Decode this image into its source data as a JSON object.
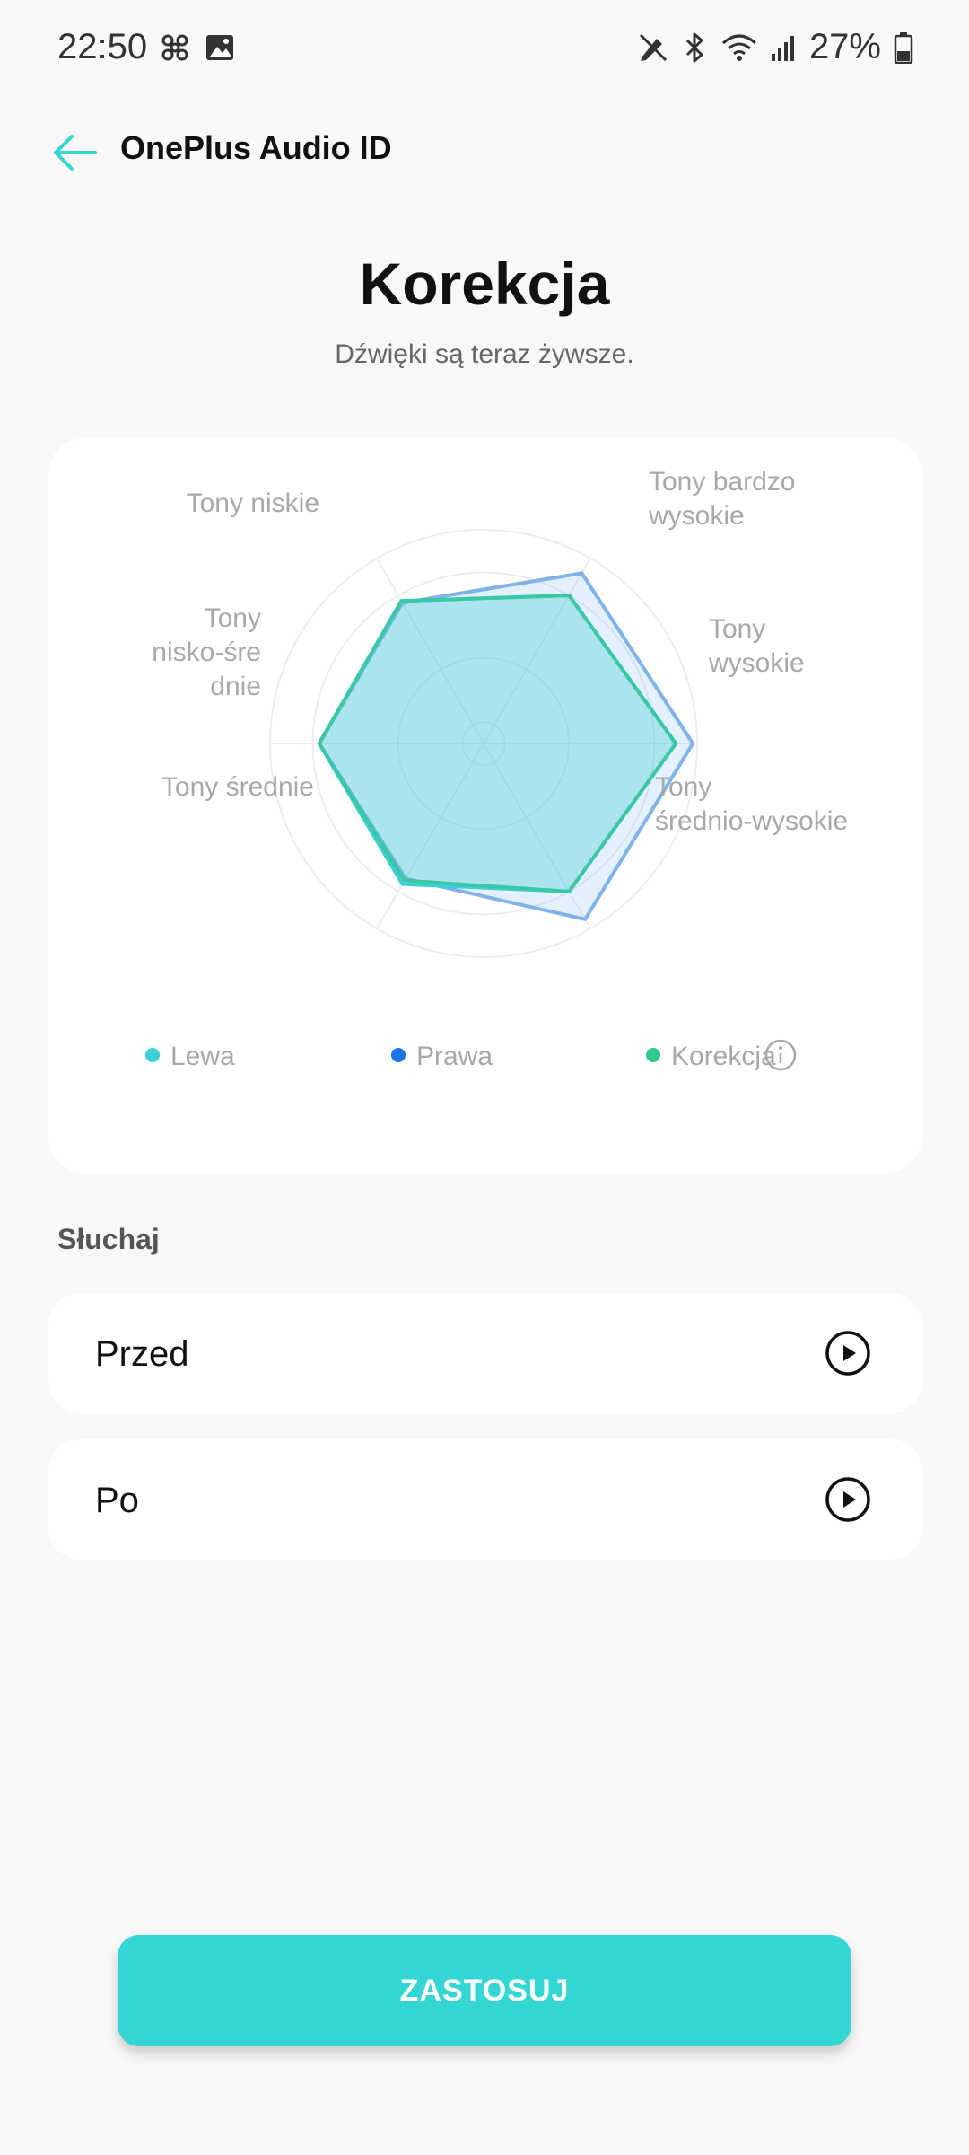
{
  "status_bar": {
    "time": "22:50",
    "battery_percent": "27%",
    "icons_left": [
      "fan-icon",
      "image-icon"
    ],
    "icons_right": [
      "pen-off-icon",
      "bluetooth-icon",
      "wifi-icon",
      "signal-icon",
      "battery-icon"
    ]
  },
  "header": {
    "back_icon": "arrow-left-icon",
    "title": "OnePlus Audio ID"
  },
  "page": {
    "title": "Korekcja",
    "subtitle": "Dźwięki są teraz żywsze."
  },
  "chart_data": {
    "type": "radar",
    "axes": [
      [
        "Tony bardzo",
        "wysokie"
      ],
      [
        "Tony",
        "wysokie"
      ],
      [
        "Tony",
        "średnio-wysokie"
      ],
      [
        "Tony średnie"
      ],
      [
        "Tony",
        "nisko-śre",
        "dnie"
      ],
      [
        "Tony niskie"
      ]
    ],
    "rmax": 1.0,
    "rings": [
      0.1,
      0.4,
      0.8,
      1.0
    ],
    "series": [
      {
        "name": "Lewa",
        "color": "#3ccfd3",
        "values": [
          0.8,
          0.9,
          0.8,
          0.76,
          0.77,
          0.77
        ]
      },
      {
        "name": "Prawa",
        "color": "#1a73e8",
        "values": [
          0.92,
          0.98,
          0.95,
          0.73,
          0.77,
          0.76
        ]
      },
      {
        "name": "Korekcja",
        "color": "#2ec98a",
        "values": [
          0.8,
          0.9,
          0.8,
          0.74,
          0.77,
          0.77
        ]
      }
    ],
    "legend": [
      {
        "label": "Lewa",
        "color": "#3ccfd3"
      },
      {
        "label": "Prawa",
        "color": "#1a73e8"
      },
      {
        "label": "Korekcja",
        "color": "#2ec98a",
        "info_icon": "info-icon"
      }
    ],
    "legend_position": "bottom"
  },
  "listen": {
    "section_label": "Słuchaj",
    "rows": [
      {
        "label": "Przed",
        "icon": "play-circle-icon"
      },
      {
        "label": "Po",
        "icon": "play-circle-icon"
      }
    ]
  },
  "apply_button": {
    "label": "ZASTOSUJ"
  }
}
